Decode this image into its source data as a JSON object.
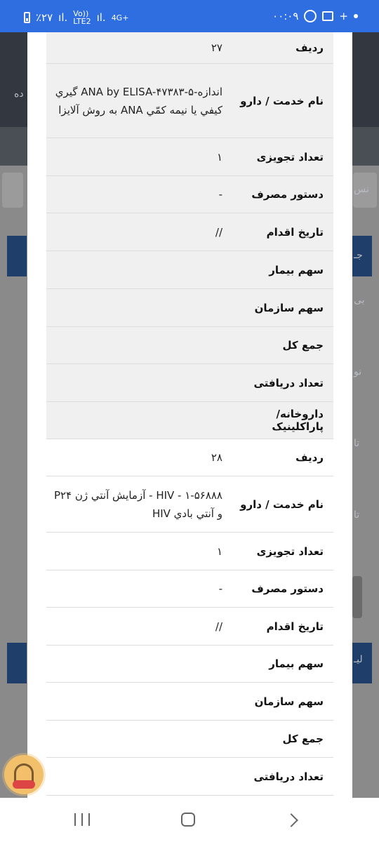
{
  "status_bar": {
    "time": "۰۰:۰۹",
    "battery": "٪۲۷",
    "network_label_1": "Vo))\nLTE2",
    "network_label_2": "4G+"
  },
  "background": {
    "partial_texts": [
      "ده",
      "نس",
      "جـ",
      "بی",
      "نو",
      "تا",
      "تا",
      "لیـ"
    ]
  },
  "records": [
    {
      "rows": [
        {
          "label": "ردیف",
          "value": "۲۷"
        },
        {
          "label": "نام خدمت / دارو",
          "value": "اندازه-ANA by ELISA-۴۷۳۸۳-۵ گيري کيفي يا نيمه کمّي ANA به روش آلايزا"
        },
        {
          "label": "تعداد تجویزی",
          "value": "۱"
        },
        {
          "label": "دستور مصرف",
          "value": "-"
        },
        {
          "label": "تاریخ اقدام",
          "value": "//"
        },
        {
          "label": "سهم بیمار",
          "value": ""
        },
        {
          "label": "سهم سازمان",
          "value": ""
        },
        {
          "label": "جمع کل",
          "value": ""
        },
        {
          "label": "تعداد دریافتی",
          "value": ""
        },
        {
          "label": "داروخانه/پاراکلینیک",
          "value": ""
        }
      ]
    },
    {
      "rows": [
        {
          "label": "ردیف",
          "value": "۲۸"
        },
        {
          "label": "نام خدمت / دارو",
          "value": "۱-۵۶۸۸۸ - HIV - آزمايش آنتي ژن P۲۴ و آنتي بادي HIV"
        },
        {
          "label": "تعداد تجویزی",
          "value": "۱"
        },
        {
          "label": "دستور مصرف",
          "value": "-"
        },
        {
          "label": "تاریخ اقدام",
          "value": "//"
        },
        {
          "label": "سهم بیمار",
          "value": ""
        },
        {
          "label": "سهم سازمان",
          "value": ""
        },
        {
          "label": "جمع کل",
          "value": ""
        },
        {
          "label": "تعداد دریافتی",
          "value": ""
        }
      ]
    }
  ]
}
